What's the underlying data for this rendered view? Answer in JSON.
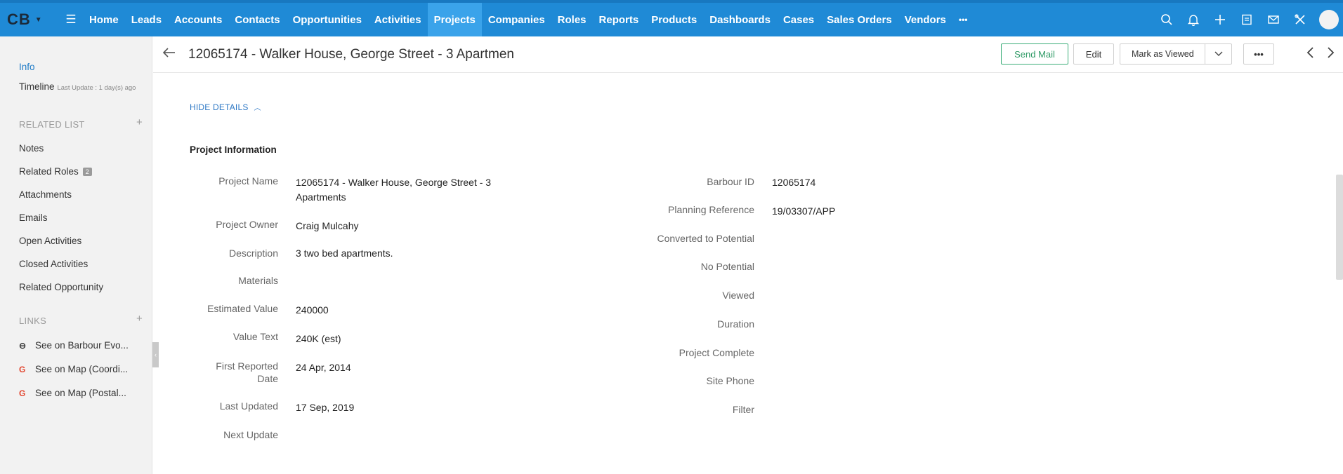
{
  "brand": "CB",
  "nav": {
    "items": [
      "Home",
      "Leads",
      "Accounts",
      "Contacts",
      "Opportunities",
      "Activities",
      "Projects",
      "Companies",
      "Roles",
      "Reports",
      "Products",
      "Dashboards",
      "Cases",
      "Sales Orders",
      "Vendors"
    ],
    "active": "Projects",
    "more": "•••",
    "icons": [
      "search-icon",
      "bell-icon",
      "plus-icon",
      "calendar-icon",
      "mail-icon",
      "tools-icon",
      "avatar"
    ]
  },
  "sidebar": {
    "info": "Info",
    "timeline": "Timeline",
    "timeline_sub": "Last Update : 1 day(s) ago",
    "related_list_head": "RELATED LIST",
    "related_items": [
      "Notes",
      "Related Roles",
      "Attachments",
      "Emails",
      "Open Activities",
      "Closed Activities",
      "Related Opportunity"
    ],
    "related_roles_badge": "2",
    "links_head": "LINKS",
    "links": [
      "See on Barbour Evo...",
      "See on Map (Coordi...",
      "See on Map (Postal..."
    ]
  },
  "header": {
    "title": "12065174 - Walker House, George Street - 3 Apartmen",
    "send_mail": "Send Mail",
    "edit": "Edit",
    "mark_viewed": "Mark as Viewed",
    "more": "•••"
  },
  "details": {
    "hide_details": "HIDE DETAILS",
    "section_title": "Project Information",
    "left_fields": [
      {
        "label": "Project Name",
        "value": "12065174 - Walker House, George Street - 3 Apartments"
      },
      {
        "label": "Project Owner",
        "value": "Craig Mulcahy"
      },
      {
        "label": "Description",
        "value": "3 two bed apartments."
      },
      {
        "label": "Materials",
        "value": ""
      },
      {
        "label": "Estimated Value",
        "value": "240000"
      },
      {
        "label": "Value Text",
        "value": "240K (est)"
      },
      {
        "label": "First Reported Date",
        "value": "24 Apr, 2014"
      },
      {
        "label": "Last Updated",
        "value": "17 Sep, 2019"
      },
      {
        "label": "Next Update",
        "value": ""
      }
    ],
    "right_fields": [
      {
        "label": "Barbour ID",
        "value": "12065174"
      },
      {
        "label": "Planning Reference",
        "value": "19/03307/APP"
      },
      {
        "label": "Converted to Potential",
        "value": ""
      },
      {
        "label": "No Potential",
        "value": ""
      },
      {
        "label": "Viewed",
        "value": ""
      },
      {
        "label": "Duration",
        "value": ""
      },
      {
        "label": "Project Complete",
        "value": ""
      },
      {
        "label": "Site Phone",
        "value": ""
      },
      {
        "label": "Filter",
        "value": ""
      }
    ]
  }
}
